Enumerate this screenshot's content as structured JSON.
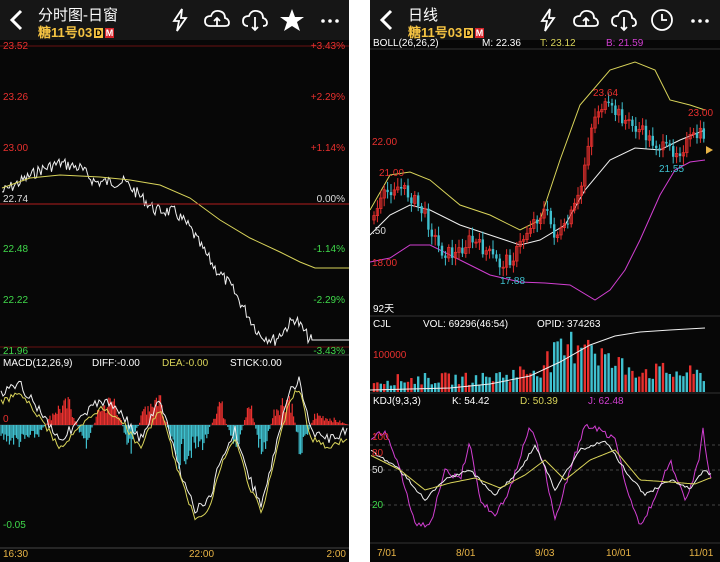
{
  "left": {
    "title": "分时图-日窗",
    "symbol": "糖11号03",
    "badge_d": "D",
    "badge_m": "M",
    "price_labels": [
      "23.52",
      "23.26",
      "23.00",
      "22.74",
      "22.48",
      "22.22",
      "21.96"
    ],
    "pct_labels": [
      "+3.43%",
      "+2.29%",
      "+1.14%",
      "0.00%",
      "-1.14%",
      "-2.29%",
      "-3.43%"
    ],
    "macd_title": "MACD(12,26,9)",
    "diff": "DIFF:-0.00",
    "dea": "DEA:-0.00",
    "stick": "STICK:0.00",
    "macd_axis": [
      "0",
      "-0.05"
    ],
    "time_labels": [
      "16:30",
      "22:00",
      "2:00"
    ]
  },
  "right": {
    "title": "日线",
    "symbol": "糖11号03",
    "badge_d": "D",
    "badge_m": "M",
    "boll_title": "BOLL(26,26,2)",
    "boll_m": "M: 22.36",
    "boll_t": "T: 23.12",
    "boll_b": "B: 21.59",
    "price_labels": [
      "22.00",
      ".50",
      "18.00"
    ],
    "annotations": [
      "23.64",
      "23.00",
      "21.55",
      "21.00",
      "17.88"
    ],
    "days": "92天",
    "cjl_title": "CJL",
    "vol": "VOL: 69296(46:54)",
    "opid": "OPID: 374263",
    "vol_axis": "100000",
    "kdj_title": "KDJ(9,3,3)",
    "k": "K: 54.42",
    "d": "D: 50.39",
    "j": "J: 62.48",
    "kdj_axis": [
      "100",
      "80",
      "50",
      "20"
    ],
    "date_labels": [
      "7/01",
      "8/01",
      "9/03",
      "10/01",
      "11/01"
    ]
  },
  "colors": {
    "up": "#e8302e",
    "down": "#3fc0cf",
    "avg": "#d9d45a",
    "boll_b": "#d23fd2",
    "green": "#3fd84a",
    "pct_up": "#e8302e",
    "gold": "#f5c342"
  }
}
